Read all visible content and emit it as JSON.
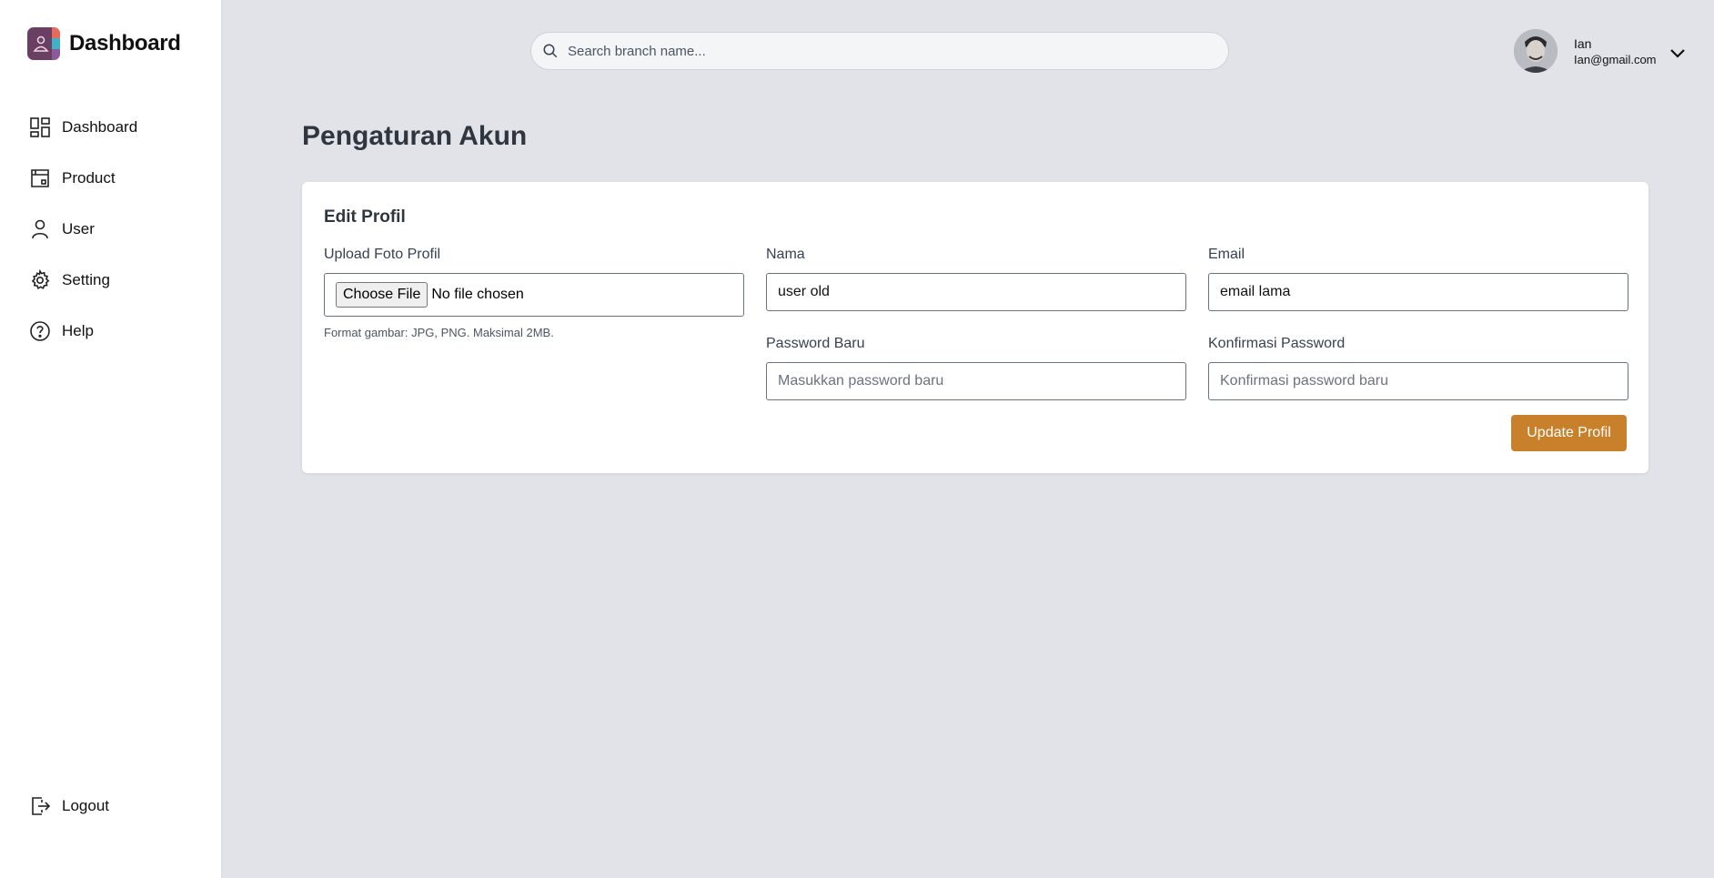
{
  "brand": {
    "title": "Dashboard",
    "icon": "app-logo"
  },
  "sidebar": {
    "items": [
      {
        "label": "Dashboard",
        "icon": "grid-icon"
      },
      {
        "label": "Product",
        "icon": "archive-box-icon"
      },
      {
        "label": "User",
        "icon": "person-icon"
      },
      {
        "label": "Setting",
        "icon": "gear-icon"
      },
      {
        "label": "Help",
        "icon": "question-circle-icon"
      }
    ],
    "logout": {
      "label": "Logout",
      "icon": "logout-icon"
    }
  },
  "header": {
    "search": {
      "placeholder": "Search branch name...",
      "value": ""
    },
    "user": {
      "name": "Ian",
      "email": "Ian@gmail.com",
      "avatar": "user-avatar"
    }
  },
  "main": {
    "title": "Pengaturan Akun",
    "card": {
      "title": "Edit Profil",
      "upload": {
        "label": "Upload Foto Profil",
        "button": "Choose File",
        "status": "No file chosen",
        "hint": "Format gambar: JPG, PNG. Maksimal 2MB."
      },
      "nama": {
        "label": "Nama",
        "value": "user old"
      },
      "email": {
        "label": "Email",
        "value": "email lama"
      },
      "password": {
        "label": "Password Baru",
        "placeholder": "Masukkan password baru"
      },
      "confirm": {
        "label": "Konfirmasi Password",
        "placeholder": "Konfirmasi password baru"
      },
      "submit": "Update Profil"
    }
  },
  "colors": {
    "accent": "#c8802a",
    "background": "#e1e3e8",
    "sidebar": "#ffffff"
  }
}
